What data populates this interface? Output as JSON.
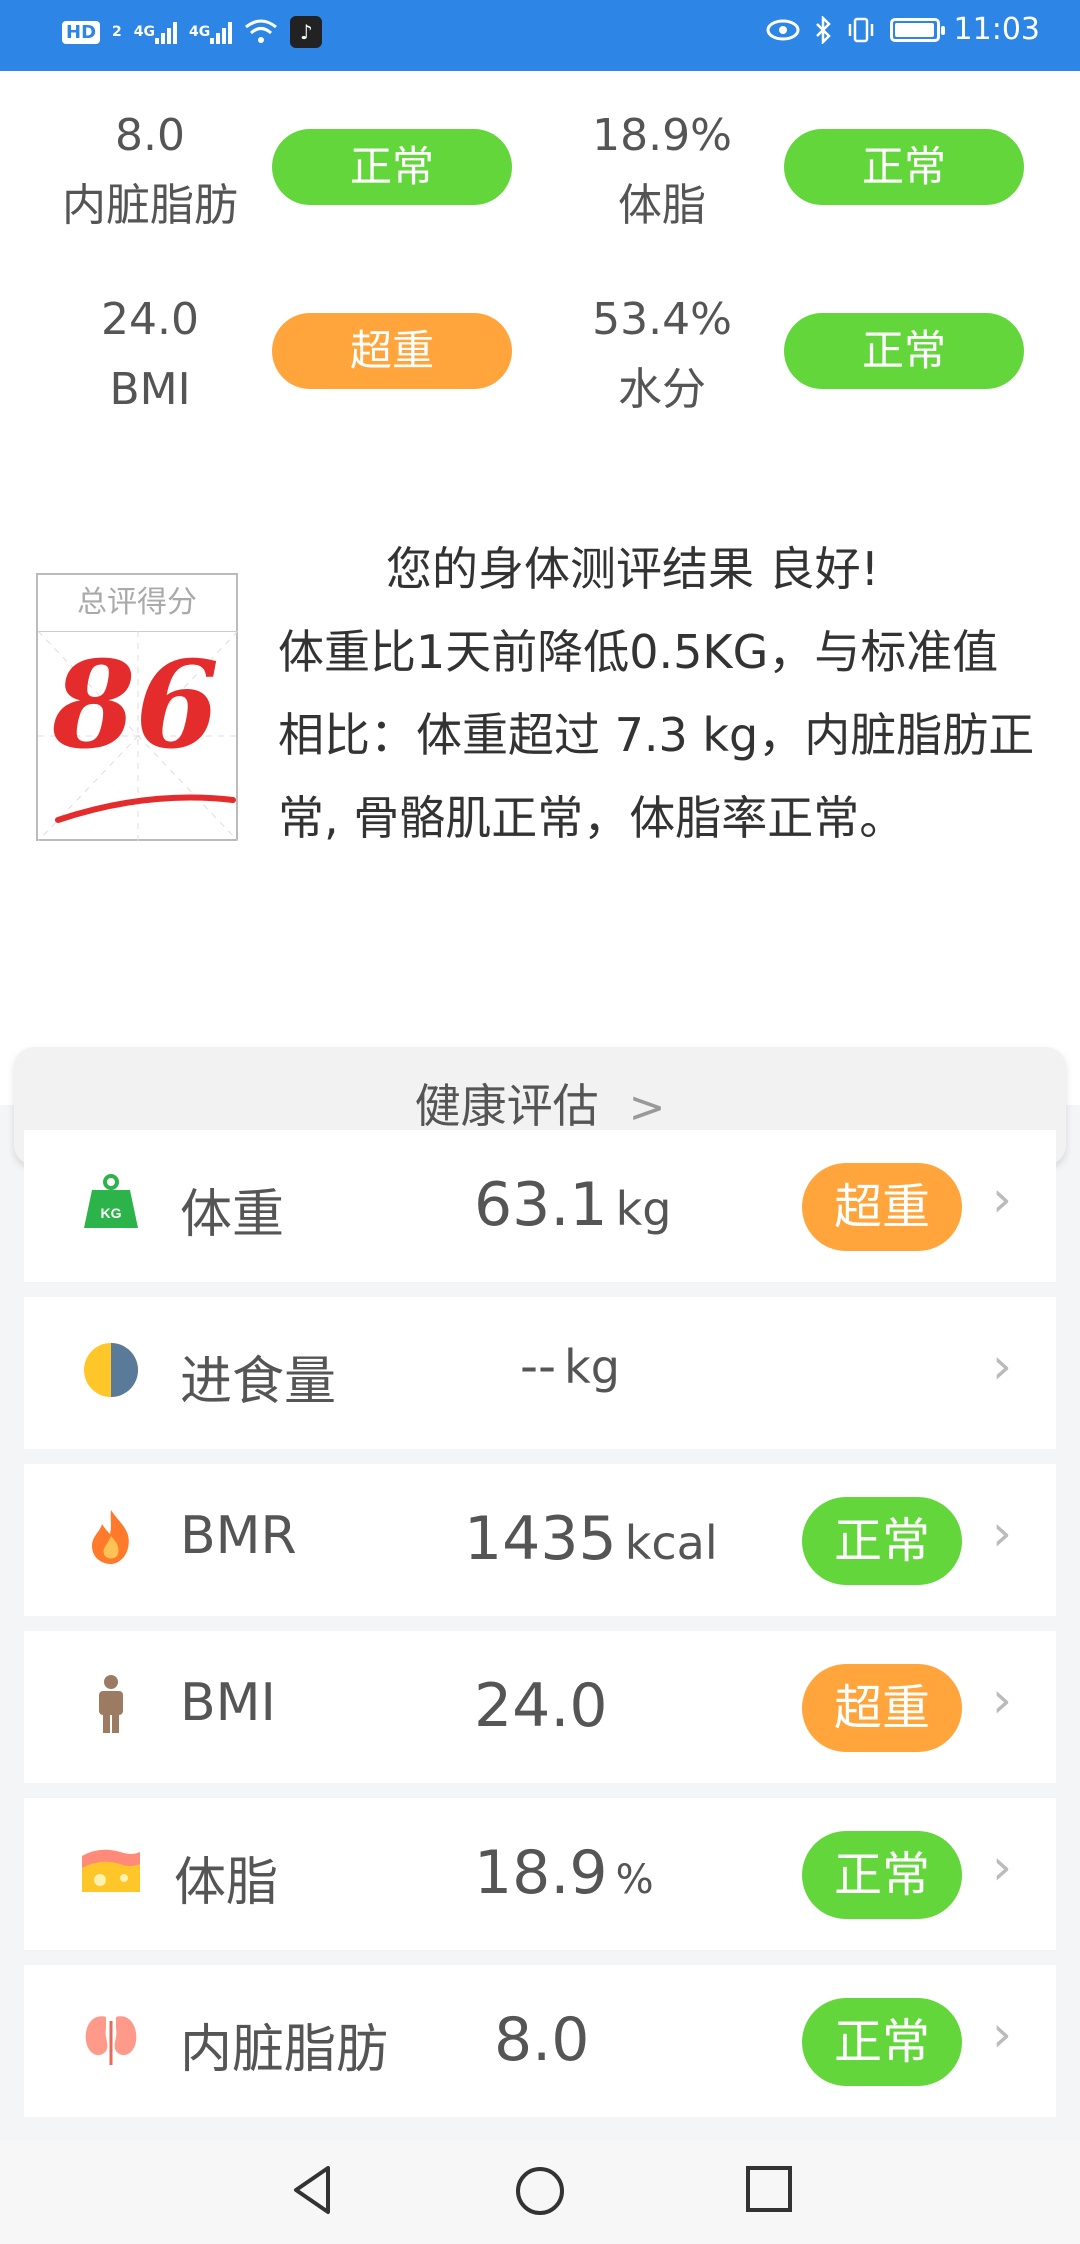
{
  "status_bar": {
    "time": "11:03",
    "hd_label": "HD",
    "sim_label": "2",
    "network_1": "4G",
    "network_2": "4G",
    "icons": [
      "hd-icon",
      "signal-icon",
      "signal-icon",
      "wifi-icon",
      "tiktok-icon",
      "eye-icon",
      "bluetooth-icon",
      "vibrate-icon",
      "battery-icon"
    ]
  },
  "metrics": [
    {
      "value": "8.0",
      "label": "内脏脂肪",
      "status": "正常",
      "status_color": "#63d63c"
    },
    {
      "value": "18.9%",
      "label": "体脂",
      "status": "正常",
      "status_color": "#63d63c"
    },
    {
      "value": "24.0",
      "label": "BMI",
      "status": "超重",
      "status_color": "#ffa53b"
    },
    {
      "value": "53.4%",
      "label": "水分",
      "status": "正常",
      "status_color": "#63d63c"
    }
  ],
  "score": {
    "label": "总评得分",
    "value": "86"
  },
  "summary": {
    "title": "您的身体测评结果 良好!",
    "text": "体重比1天前降低0.5KG，与标准值相比：体重超过 7.3 kg，内脏脂肪正常, 骨骼肌正常，体脂率正常。"
  },
  "assessment_button": {
    "label": "健康评估"
  },
  "list": [
    {
      "name": "体重",
      "value": "63.1",
      "unit": "kg",
      "status": "超重",
      "icon": "weight-icon"
    },
    {
      "name": "进食量",
      "value": "--",
      "unit": "kg",
      "status": "",
      "icon": "meal-icon"
    },
    {
      "name": "BMR",
      "value": "1435",
      "unit": "kcal",
      "status": "正常",
      "icon": "fire-icon"
    },
    {
      "name": "BMI",
      "value": "24.0",
      "unit": "",
      "status": "超重",
      "icon": "person-icon"
    },
    {
      "name": "体脂",
      "value": "18.9",
      "unit": "%",
      "status": "正常",
      "icon": "fat-icon"
    },
    {
      "name": "内脏脂肪",
      "value": "8.0",
      "unit": "",
      "status": "正常",
      "icon": "organ-icon"
    }
  ],
  "colors": {
    "accent": "#2d86e5",
    "normal": "#63d63c",
    "overweight": "#ffa53b",
    "score_red": "#e42c2c"
  }
}
